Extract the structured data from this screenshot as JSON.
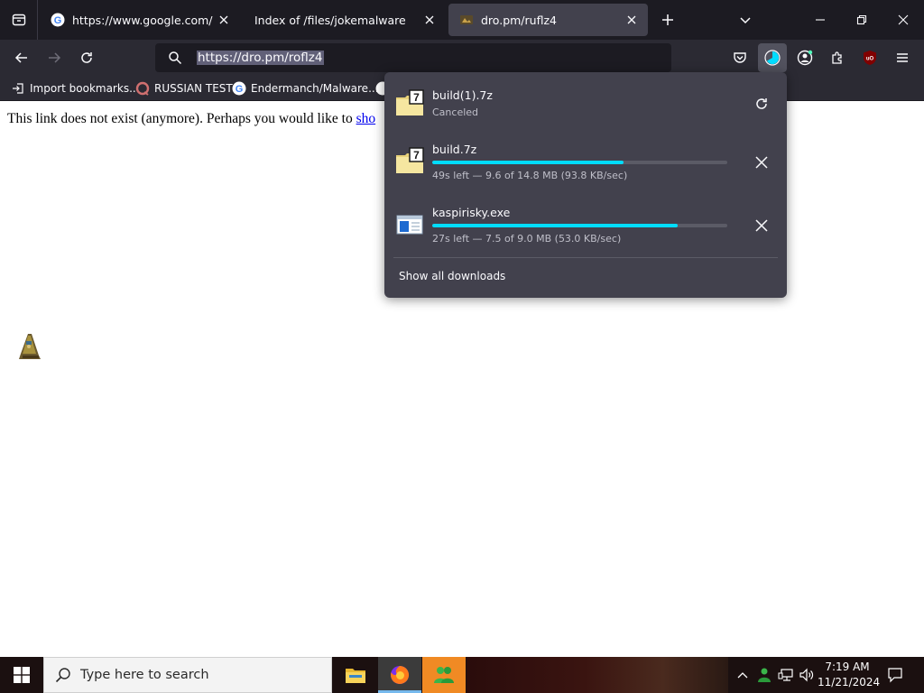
{
  "browser": {
    "tabs": [
      {
        "title": "https://www.google.com/searc",
        "favicon": "google-icon",
        "active": false
      },
      {
        "title": "Index of /files/jokemalware",
        "favicon": "none",
        "active": false
      },
      {
        "title": "dro.pm/ruflz4",
        "favicon": "dro-pm-icon",
        "active": true
      }
    ],
    "url": "https://dro.pm/roflz4",
    "bookmarks": [
      {
        "label": "Import bookmarks...",
        "icon": "import-icon"
      },
      {
        "label": "RUSSIAN TEST",
        "icon": "russian-test-icon"
      },
      {
        "label": "Endermanch/Malware...",
        "icon": "google-icon"
      }
    ]
  },
  "page": {
    "message": "This link does not exist (anymore). Perhaps you would like to ",
    "link_text": "sho"
  },
  "downloads": {
    "items": [
      {
        "name": "build(1).7z",
        "status": "Canceled",
        "action": "retry",
        "icon": "7zip-archive-icon"
      },
      {
        "name": "build.7z",
        "status": "49s left — 9.6 of 14.8 MB (93.8 KB/sec)",
        "progress": 0.649,
        "action": "cancel",
        "icon": "7zip-archive-icon"
      },
      {
        "name": "kaspirisky.exe",
        "status": "27s left — 7.5 of 9.0 MB (53.0 KB/sec)",
        "progress": 0.833,
        "action": "cancel",
        "icon": "exe-file-icon"
      }
    ],
    "show_all": "Show all downloads"
  },
  "taskbar": {
    "search_placeholder": "Type here to search",
    "time": "7:19 AM",
    "date": "11/21/2024"
  },
  "colors": {
    "tab_strip": "#1c1b22",
    "toolbar": "#2b2a33",
    "panel": "#42414d",
    "progress_fill": "#00ddff",
    "link": "#0000ee"
  }
}
